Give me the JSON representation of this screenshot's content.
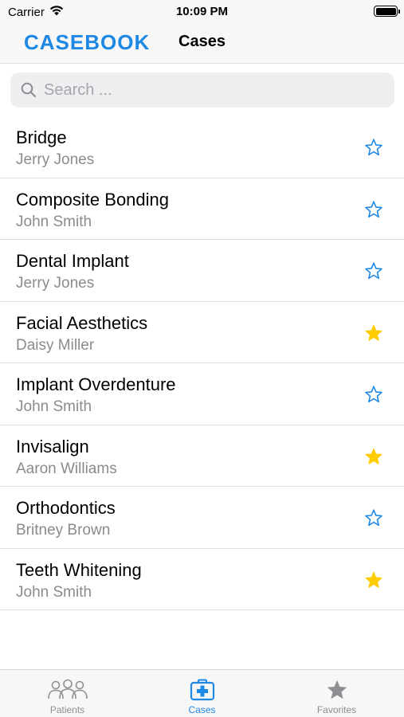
{
  "status_bar": {
    "carrier": "Carrier",
    "time": "10:09 PM",
    "battery_level": 1.0
  },
  "nav": {
    "brand": "CASEBOOK",
    "title": "Cases"
  },
  "search": {
    "placeholder": "Search ...",
    "value": ""
  },
  "cases": [
    {
      "title": "Bridge",
      "patient": "Jerry Jones",
      "favorite": false
    },
    {
      "title": "Composite Bonding",
      "patient": "John Smith",
      "favorite": false
    },
    {
      "title": "Dental Implant",
      "patient": "Jerry Jones",
      "favorite": false
    },
    {
      "title": "Facial Aesthetics",
      "patient": "Daisy Miller",
      "favorite": true
    },
    {
      "title": "Implant Overdenture",
      "patient": "John Smith",
      "favorite": false
    },
    {
      "title": "Invisalign",
      "patient": "Aaron Williams",
      "favorite": true
    },
    {
      "title": "Orthodontics",
      "patient": "Britney Brown",
      "favorite": false
    },
    {
      "title": "Teeth Whitening",
      "patient": "John Smith",
      "favorite": true
    }
  ],
  "tabs": [
    {
      "label": "Patients",
      "icon": "people-icon",
      "active": false
    },
    {
      "label": "Cases",
      "icon": "medical-kit-icon",
      "active": true
    },
    {
      "label": "Favorites",
      "icon": "star-icon",
      "active": false
    }
  ],
  "colors": {
    "accent": "#1e88e5",
    "favorite_star": "#ffcc00",
    "inactive_tab": "#8e8e93",
    "secondary_text": "#8b8b8f"
  }
}
